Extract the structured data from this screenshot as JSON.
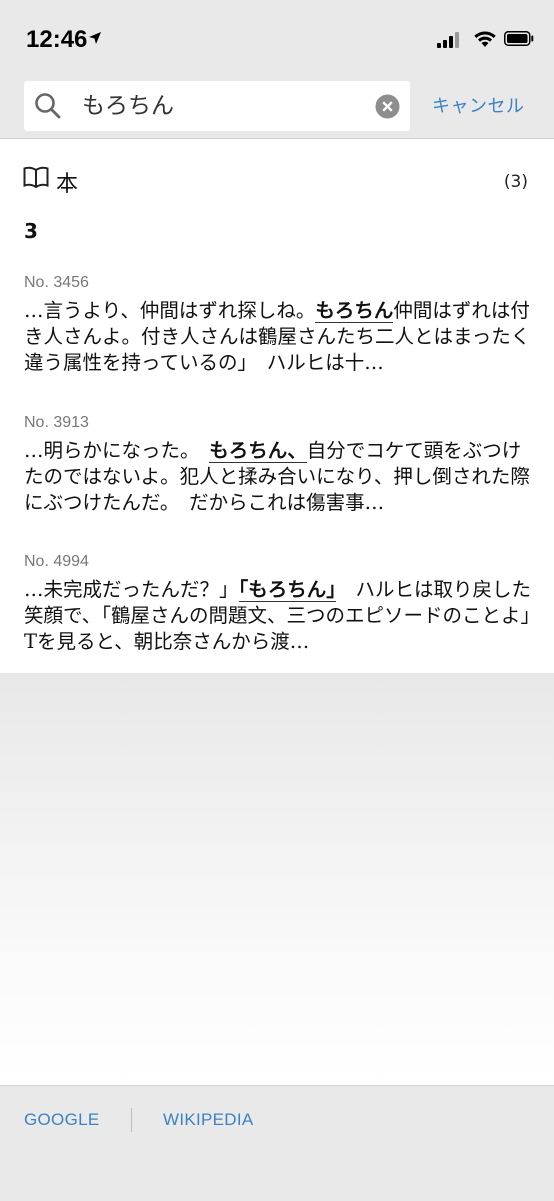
{
  "status_bar": {
    "time": "12:46"
  },
  "search": {
    "query": "もろちん",
    "cancel_label": "キャンセル"
  },
  "section": {
    "title": "本",
    "count": "(3)",
    "group_label": "3"
  },
  "results": [
    {
      "location": "No. 3456",
      "before": "…言うより、仲間はずれ探しね。",
      "match": "もろちん",
      "after": "仲間はずれは付き人さんよ。付き人さんは鶴屋さんたち二人とはまったく違う属性を持っているの」　ハルヒは十…"
    },
    {
      "location": "No. 3913",
      "before": "…明らかになった。　",
      "match": "もろちん、",
      "after": "自分でコケて頭をぶつけたのではないよ。犯人と揉み合いになり、押し倒された際にぶつけたんだ。　だからこれは傷害事…"
    },
    {
      "location": "No. 4994",
      "before": "…未完成だったんだ？」",
      "match": "「もろちん」",
      "after": "　ハルヒは取り戻した笑顔で、「鶴屋さんの問題文、三つのエピソードのことよ」　Tを見ると、朝比奈さんから渡…"
    }
  ],
  "footer": {
    "google_label": "GOOGLE",
    "wikipedia_label": "WIKIPEDIA"
  },
  "colors": {
    "accent": "#3b83c4",
    "header_bg": "#e9e9e9"
  }
}
